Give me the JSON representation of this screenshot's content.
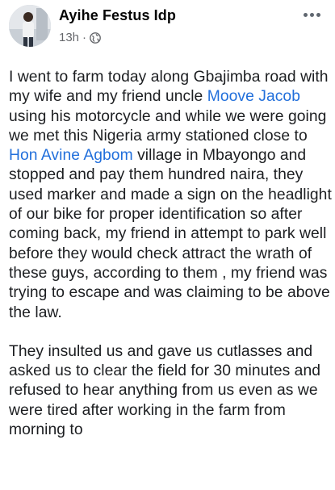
{
  "post": {
    "author": "Ayihe Festus Idp",
    "time": "13h",
    "separator": "·",
    "privacy_icon": "globe-icon",
    "more_icon": "more-options-icon",
    "paragraph1": {
      "t1": "I went to farm today along Gbajimba road with my wife and my friend uncle ",
      "link1": "Moove Jacob",
      "t2": " using his motorcycle and while we were going we met this Nigeria army stationed close to ",
      "link2": "Hon Avine Agbom",
      "t3": " village in Mbayongo and stopped and pay them hundred naira, they used marker and made a sign on the headlight of our bike for proper identification so after coming back, my friend in attempt to park well before they would check attract the wrath of these guys, according to them , my friend was trying to escape and was claiming to be above the law."
    },
    "paragraph2": "They insulted us and gave us cutlasses and asked us to clear the field for 30 minutes and refused to hear anything from us even as we were tired after working in the farm from morning to"
  },
  "colors": {
    "link": "#216fdb",
    "text": "#1c1e21",
    "meta": "#65676b"
  }
}
